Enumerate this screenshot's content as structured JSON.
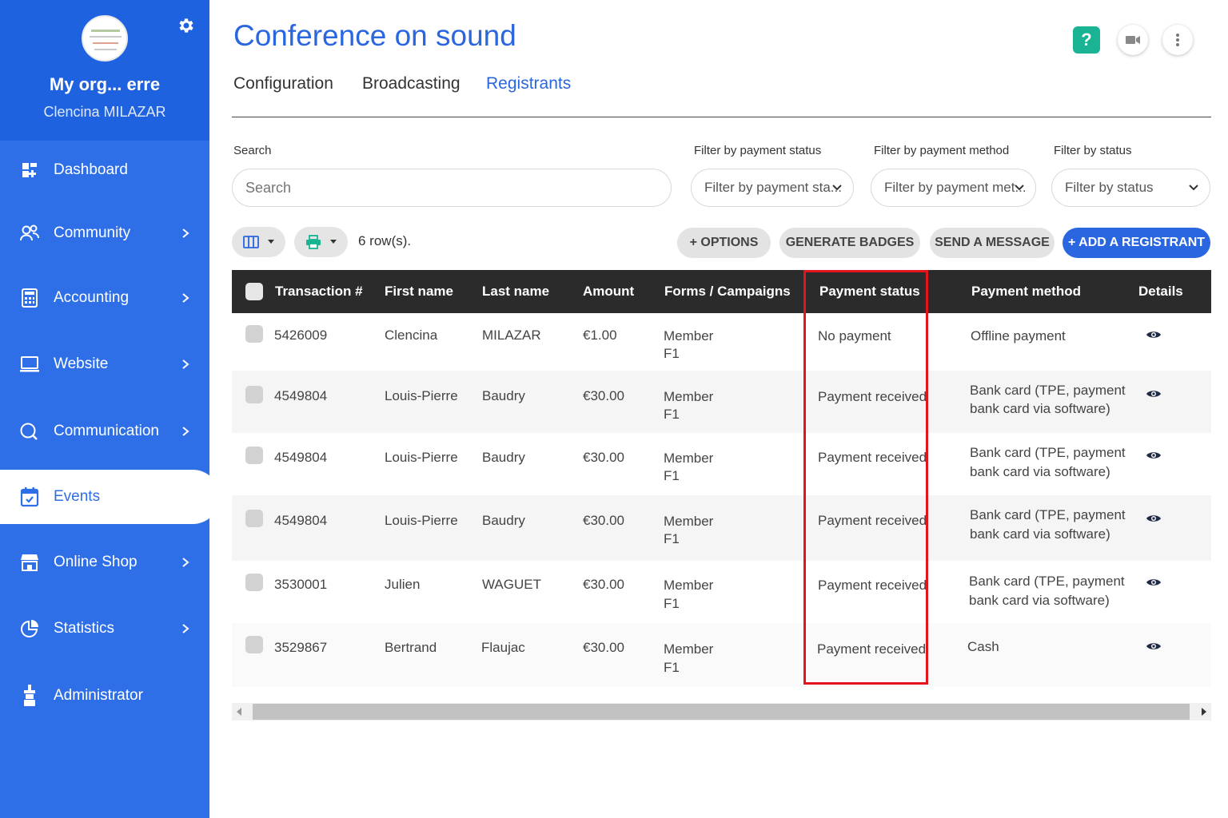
{
  "sidebar": {
    "org_name": "My org... erre",
    "user_name": "Clencina MILAZAR",
    "items": [
      {
        "label": "Dashboard",
        "icon": "dashboard-icon",
        "chevron": false
      },
      {
        "label": "Community",
        "icon": "community-icon",
        "chevron": true
      },
      {
        "label": "Accounting",
        "icon": "calculator-icon",
        "chevron": true
      },
      {
        "label": "Website",
        "icon": "laptop-icon",
        "chevron": true
      },
      {
        "label": "Communication",
        "icon": "chat-icon",
        "chevron": true
      },
      {
        "label": "Events",
        "icon": "calendar-icon",
        "chevron": false,
        "active": true
      },
      {
        "label": "Online Shop",
        "icon": "shop-icon",
        "chevron": true
      },
      {
        "label": "Statistics",
        "icon": "pie-chart-icon",
        "chevron": true
      },
      {
        "label": "Administrator",
        "icon": "admin-icon",
        "chevron": false
      }
    ]
  },
  "page": {
    "title": "Conference on sound",
    "help_label": "?"
  },
  "tabs": [
    {
      "label": "Configuration"
    },
    {
      "label": "Broadcasting"
    },
    {
      "label": "Registrants",
      "active": true
    }
  ],
  "filters": {
    "search_label": "Search",
    "search_placeholder": "Search",
    "payment_status_label": "Filter by payment status",
    "payment_status_value": "Filter by payment sta...",
    "payment_method_label": "Filter by payment method",
    "payment_method_value": "Filter by payment met...",
    "status_label": "Filter by status",
    "status_value": "Filter by status"
  },
  "toolbar": {
    "row_count": "6 row(s).",
    "options": "+ OPTIONS",
    "generate_badges": "GENERATE BADGES",
    "send_message": "SEND A MESSAGE",
    "add_registrant": "+ ADD A REGISTRANT"
  },
  "table": {
    "headers": {
      "transaction": "Transaction #",
      "first_name": "First name",
      "last_name": "Last name",
      "amount": "Amount",
      "forms": "Forms / Campaigns",
      "payment_status": "Payment status",
      "payment_method": "Payment method",
      "details": "Details"
    },
    "rows": [
      {
        "transaction": "5426009",
        "first_name": "Clencina",
        "last_name": "MILAZAR",
        "amount": "€1.00",
        "forms_1": "Member",
        "forms_2": "F1",
        "payment_status": "No payment",
        "method_1": "Offline payment",
        "method_2": ""
      },
      {
        "transaction": "4549804",
        "first_name": "Louis-Pierre",
        "last_name": "Baudry",
        "amount": "€30.00",
        "forms_1": "Member",
        "forms_2": "F1",
        "payment_status": "Payment received",
        "method_1": "Bank card (TPE, payment",
        "method_2": "bank card via software)"
      },
      {
        "transaction": "4549804",
        "first_name": "Louis-Pierre",
        "last_name": "Baudry",
        "amount": "€30.00",
        "forms_1": "Member",
        "forms_2": "F1",
        "payment_status": "Payment received",
        "method_1": "Bank card (TPE, payment",
        "method_2": "bank card via software)"
      },
      {
        "transaction": "4549804",
        "first_name": "Louis-Pierre",
        "last_name": "Baudry",
        "amount": "€30.00",
        "forms_1": "Member",
        "forms_2": "F1",
        "payment_status": "Payment received",
        "method_1": "Bank card (TPE, payment",
        "method_2": "bank card via software)"
      },
      {
        "transaction": "3530001",
        "first_name": "Julien",
        "last_name": "WAGUET",
        "amount": "€30.00",
        "forms_1": "Member",
        "forms_2": "F1",
        "payment_status": "Payment received",
        "method_1": "Bank card (TPE, payment",
        "method_2": "bank card via software)"
      },
      {
        "transaction": "3529867",
        "first_name": "Bertrand",
        "last_name": "Flaujac",
        "amount": "€30.00",
        "forms_1": "Member",
        "forms_2": "F1",
        "payment_status": "Payment received",
        "method_1": "Cash",
        "method_2": ""
      }
    ]
  },
  "colors": {
    "sidebar": "#2e6fe8",
    "accent": "#2a66e0",
    "help_green": "#1ab394",
    "highlight_red": "#e3141b",
    "table_header": "#2b2b2b"
  }
}
